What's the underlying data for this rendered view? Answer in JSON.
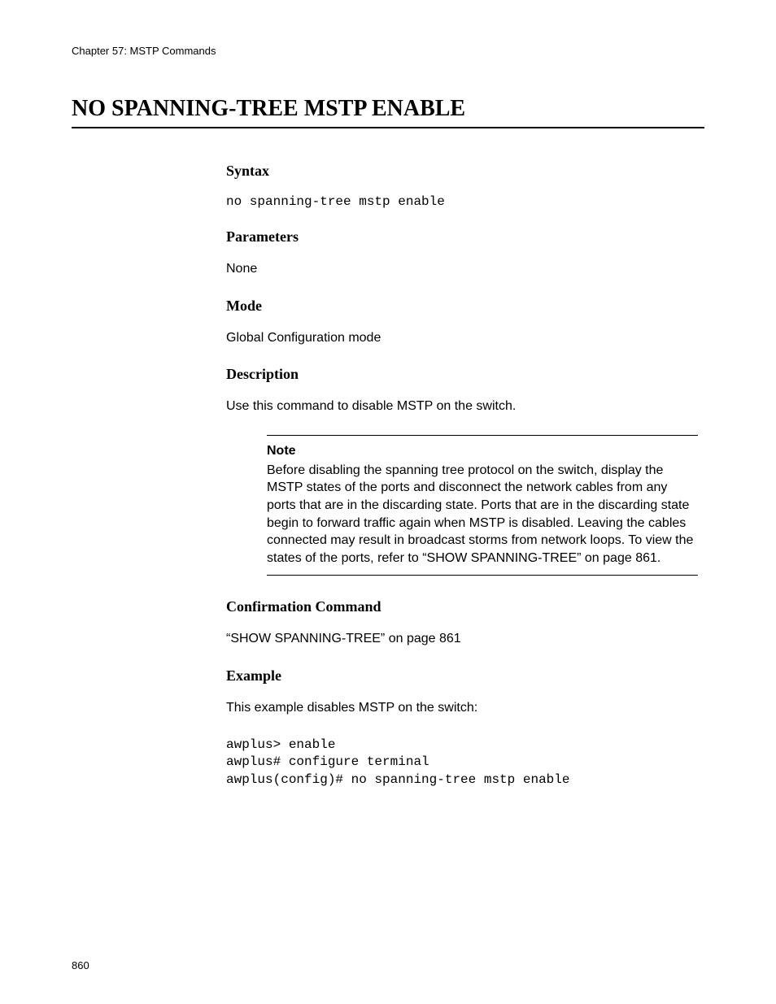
{
  "header": "Chapter 57: MSTP Commands",
  "title": "NO SPANNING-TREE MSTP ENABLE",
  "sections": {
    "syntax": {
      "heading": "Syntax",
      "code": "no spanning-tree mstp enable"
    },
    "parameters": {
      "heading": "Parameters",
      "text": "None"
    },
    "mode": {
      "heading": "Mode",
      "text": "Global Configuration mode"
    },
    "description": {
      "heading": "Description",
      "text": "Use this command to disable MSTP on the switch."
    },
    "note": {
      "label": "Note",
      "body": "Before disabling the spanning tree protocol on the switch, display the MSTP states of the ports and disconnect the network cables from any ports that are in the discarding state. Ports that are in the discarding state begin to forward traffic again when MSTP is disabled. Leaving the cables connected may result in broadcast storms from network loops. To view the states of the ports, refer to “SHOW SPANNING-TREE” on page 861."
    },
    "confirmation": {
      "heading": "Confirmation Command",
      "text": "“SHOW SPANNING-TREE” on page 861"
    },
    "example": {
      "heading": "Example",
      "text": "This example disables MSTP on the switch:",
      "code": "awplus> enable\nawplus# configure terminal\nawplus(config)# no spanning-tree mstp enable"
    }
  },
  "page_number": "860"
}
